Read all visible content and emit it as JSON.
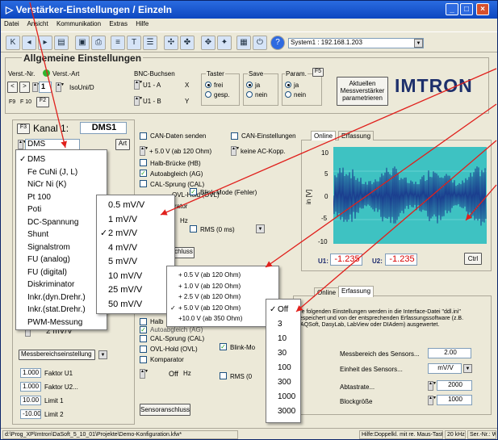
{
  "window": {
    "title": "Verstärker-Einstellungen / Einzeln"
  },
  "menu": [
    "Datei",
    "Ansicht",
    "Kommunikation",
    "Extras",
    "Hilfe"
  ],
  "toolbar": {
    "system_select": "System1 : 192.168.1.203"
  },
  "general": {
    "title": "Allgemeine Einstellungen",
    "verst_nr_label": "Verst.-Nr.",
    "verst_art_label": "Verst.-Art",
    "verst_nr_value": "1",
    "verst_art_value": "IsoUni/D",
    "btn_prev": "<",
    "btn_next": ">",
    "f9": "F9",
    "f10": "F 10",
    "f2": "F2",
    "bnc_label": "BNC-Buchsen",
    "bnc_x_value": "U1 - A",
    "bnc_y_value": "U1 - B",
    "x_label": "X",
    "y_label": "Y",
    "taster_label": "Taster",
    "taster_opt1": "frei",
    "taster_opt2": "gesp.",
    "save_label": "Save",
    "save_opt1": "ja",
    "save_opt2": "nein",
    "param_label": "Param.",
    "param_opt1": "ja",
    "param_opt2": "nein",
    "f5": "F5",
    "apply_button": "Aktuellen Messverstärker parametrieren",
    "logo": "IMTRON"
  },
  "channel": {
    "f3": "F3",
    "label": "Kanal 1:",
    "name": "DMS1",
    "type_value": "DMS",
    "art_button": "Art",
    "range_value": "2 mV/V",
    "f4": "F"
  },
  "type_menu": [
    "DMS",
    "Fe CuNi (J, L)",
    "NiCr Ni (K)",
    "Pt 100",
    "Poti",
    "DC-Spannung",
    "Shunt",
    "Signalstrom",
    "FU (analog)",
    "FU (digital)",
    "Diskriminator",
    "Inkr.(dyn.Drehr.)",
    "Inkr.(stat.Drehr.)",
    "PWM-Messung"
  ],
  "type_menu_checked": "DMS",
  "range_menu": [
    "0.5 mV/V",
    "1 mV/V",
    "2 mV/V",
    "4 mV/V",
    "5 mV/V",
    "10 mV/V",
    "25 mV/V",
    "50 mV/V"
  ],
  "range_menu_checked": "2 mV/V",
  "excitation_menu": [
    "+ 0.5 V (ab 120 Ohm)",
    "+ 1.0 V (ab 120 Ohm)",
    "+ 2.5 V (ab 120 Ohm)",
    "+ 5.0 V (ab 120 Ohm)",
    "+10.0 V (ab 350 Ohm)"
  ],
  "excitation_menu_checked": "+ 5.0 V (ab 120 Ohm)",
  "rms_menu": [
    "Off",
    "3",
    "10",
    "30",
    "100",
    "300",
    "1000",
    "3000"
  ],
  "rms_menu_checked": "Off",
  "middle": {
    "can_send": "CAN-Daten senden",
    "can_settings": "CAN-Einstellungen",
    "excitation_value": "+ 5.0 V (ab 120 Ohm)",
    "can_coupling_value": "keine AC-Kopp.",
    "half_bridge": "Halb-Brücke (HB)",
    "auto_zero": "Autoabgleich (AG)",
    "cal_jump": "CAL-Sprung (CAL)",
    "ovl_hold": "OVL-Hold (OVL)",
    "comparator_partial": "rator",
    "hz_unit": "Hz",
    "blink_mode": "Blink-Mode (Fehler)",
    "rms_label": "RMS (0 ms)",
    "sensor_connect_partial": "chluss",
    "off_value": "Off",
    "off_unit": "Hz",
    "blink_mode_partial": "Blink-Mo",
    "rms_partial": "RMS (0",
    "comparator": "Komparator",
    "sensor_connect": "Sensoranschluss",
    "half_bridge_partial": "Halb",
    "auto_zero_partial": "Autoabgleich (AG)",
    "tab_partial": "ungen"
  },
  "lower_left": {
    "range_settings": "Messbereichseinstellung",
    "factor_u1_value": "1.000",
    "factor_u1_label": "Faktor U1",
    "factor_u2_value": "1.000",
    "factor_u2_label": "Faktor U2...",
    "limit1_value": "10.00",
    "limit1_label": "Limit 1",
    "limit2_value": "-10.00",
    "limit2_label": "Limit 2"
  },
  "scope": {
    "tab_online": "Online",
    "tab_capture": "Erfassung",
    "ylabel": "in [V]",
    "yticks": [
      "10",
      "5",
      "0",
      "-5",
      "-10"
    ],
    "u1_label": "U1:",
    "u1_value": "-1.235",
    "u2_label": "U2:",
    "u2_value": "-1.235",
    "ctrl_button": "Ctrl"
  },
  "capture": {
    "tab_online": "Online",
    "tab_capture": "Erfassung",
    "info_text": "Die folgenden Einstellungen werden in die Interface-Datei \"ddl.ini\" gespeichert und von der entsprechenden Erfassungssoftware (z.B. DAQSoft, DasyLab, LabView oder DIAdem) ausgewertet.",
    "sensor_range_label": "Messbereich des Sensors...",
    "sensor_range_value": "2.00",
    "sensor_unit_label": "Einheit des Sensors...",
    "sensor_unit_value": "mV/V",
    "sample_rate_label": "Abtastrate...",
    "sample_rate_value": "2000",
    "block_size_label": "Blockgröße",
    "block_size_value": "1000"
  },
  "statusbar": {
    "path": "d:\\Prog_XP\\Imtron\\DaSoft_5_10_01\\Projekte\\Demo-Konfiguration.kfw*",
    "hint": "Hilfe:Doppelkl. mit re. Maus-Taste!",
    "rate": "20 kHz",
    "serial": "Ser.-Nr.: WDS-5.12.04-9999"
  },
  "colors": {
    "titlebar": "#0d47c0",
    "scope_bg": "#3ec2c2",
    "signal": "#1b3f8f",
    "arrow": "#e0201c",
    "readout": "#d80000"
  }
}
